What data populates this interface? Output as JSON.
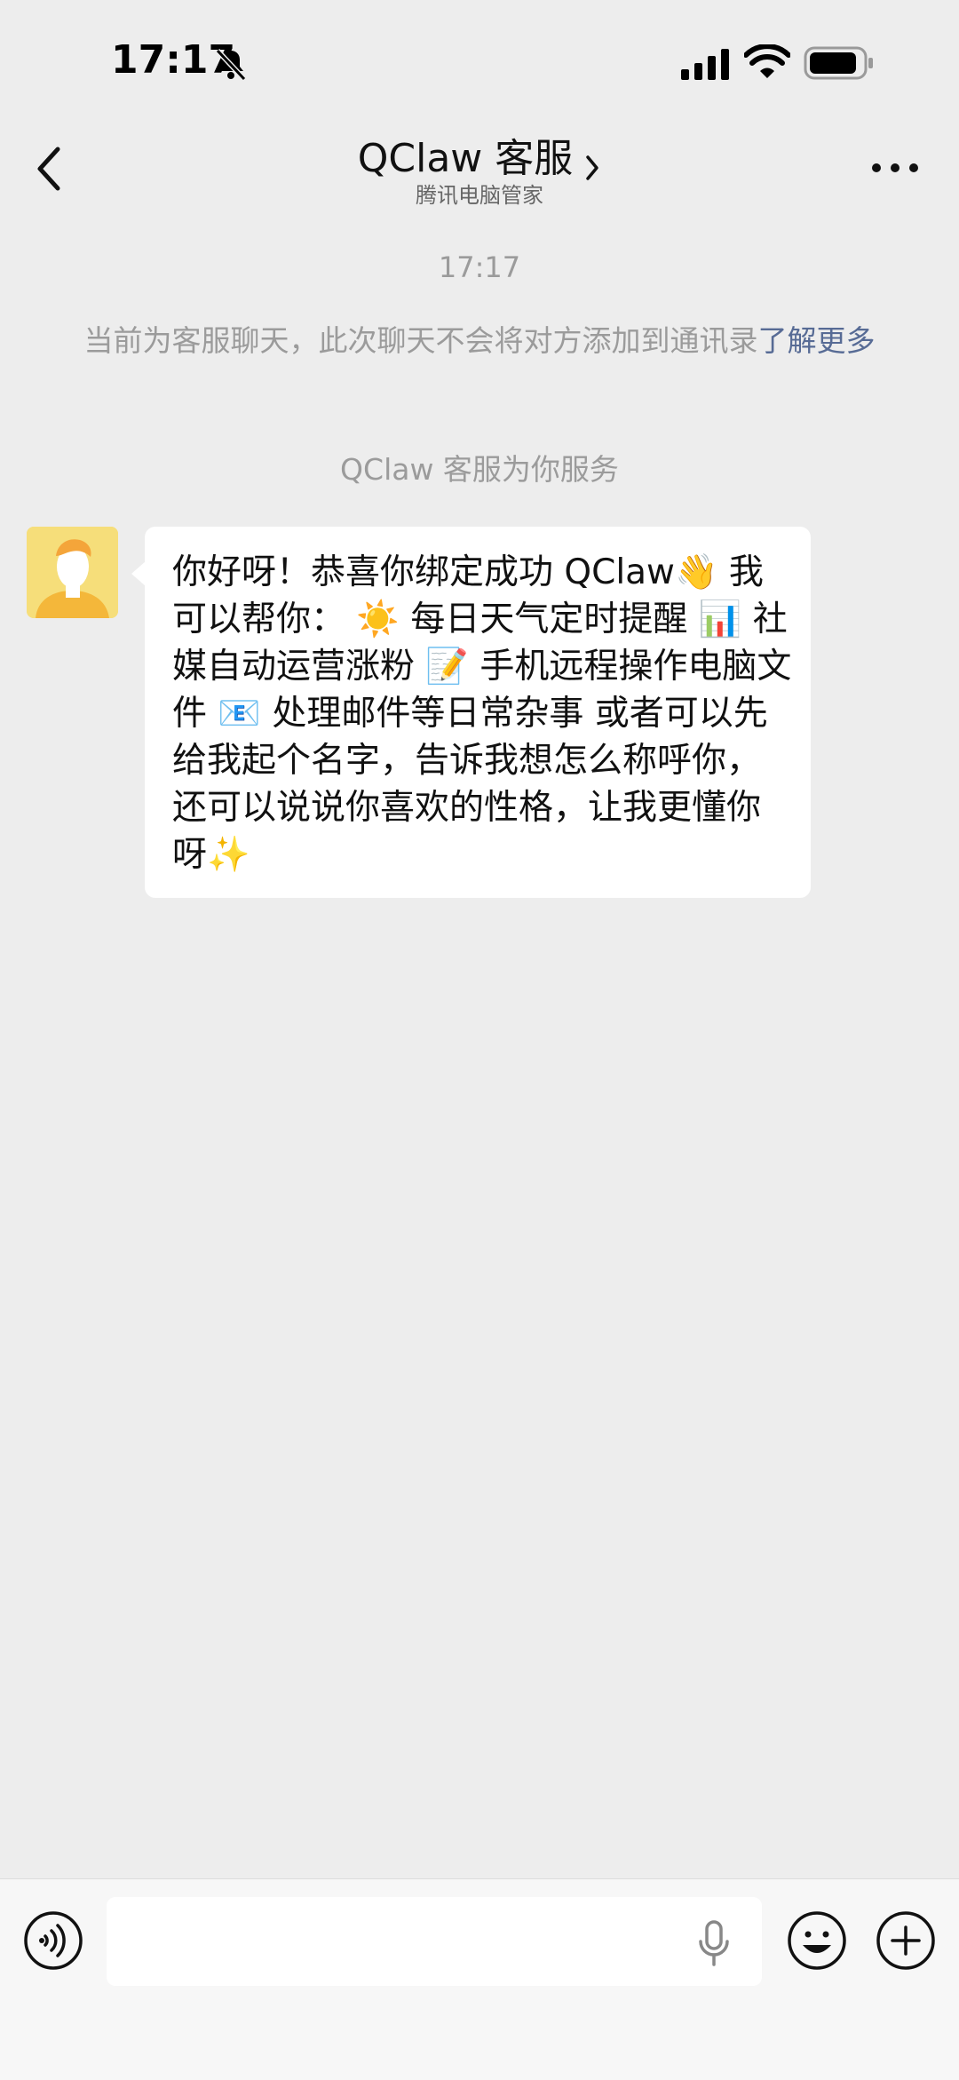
{
  "status_bar": {
    "time": "17:17",
    "icons": [
      "bell-slash-icon",
      "signal-icon",
      "wifi-icon",
      "battery-icon"
    ]
  },
  "header": {
    "title": "QClaw 客服",
    "subtitle": "腾讯电脑管家",
    "back_icon": "chevron-left-icon",
    "title_icon": "chevron-right-icon",
    "more_icon": "more-icon"
  },
  "chat": {
    "timestamp": "17:17",
    "notice_text": "当前为客服聊天，此次聊天不会将对方添加到通讯录",
    "notice_link": "了解更多",
    "service_note": "QClaw 客服为你服务",
    "message": {
      "text": "你好呀！恭喜你绑定成功 QClaw👋 我可以帮你： ☀️ 每日天气定时提醒 📊 社媒自动运营涨粉 📝 手机远程操作电脑文件 📧 处理邮件等日常杂事 或者可以先给我起个名字，告诉我想怎么称呼你，还可以说说你喜欢的性格，让我更懂你呀✨"
    }
  },
  "input_bar": {
    "voice_icon": "voice-icon",
    "input_value": "",
    "input_placeholder": "",
    "mic_icon": "mic-icon",
    "emoji_icon": "emoji-icon",
    "plus_icon": "plus-icon"
  },
  "colors": {
    "background": "#ededed",
    "bubble": "#ffffff",
    "link": "#576b95",
    "system_text": "#9b9b9b",
    "avatar_bg": "#f6de7a"
  }
}
